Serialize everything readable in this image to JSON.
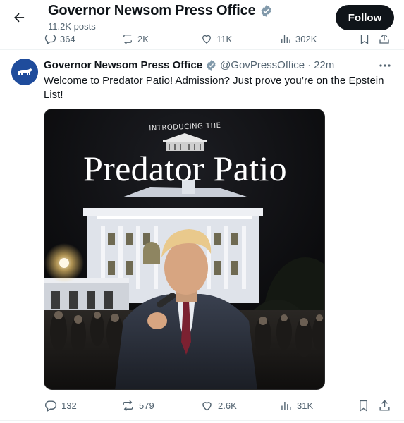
{
  "header": {
    "profile_name": "Governor Newsom Press Office",
    "post_count": "11.2K posts",
    "follow_label": "Follow"
  },
  "previous_tweet_actions": {
    "replies": "364",
    "reposts": "2K",
    "likes": "11K",
    "views": "302K"
  },
  "tweet": {
    "author_name": "Governor Newsom Press Office",
    "handle": "@GovPressOffice",
    "separator": "·",
    "time": "22m",
    "text": "Welcome to Predator Patio! Admission? Just prove you’re on the Epstein List!",
    "media": {
      "kicker": "INTRODUCING THE",
      "title": "Predator Patio"
    },
    "actions": {
      "replies": "132",
      "reposts": "579",
      "likes": "2.6K",
      "views": "31K"
    }
  },
  "colors": {
    "text_primary": "#0f1419",
    "text_secondary": "#536471",
    "verified_badge": "#829aab",
    "avatar_bg": "#1f4c9c",
    "follow_bg": "#0f1419"
  },
  "icons": {
    "back": "arrow-left-icon",
    "verified": "verified-badge-icon",
    "more": "more-dots-icon",
    "reply": "reply-bubble-icon",
    "repost": "repost-arrows-icon",
    "like": "heart-icon",
    "views": "bar-chart-icon",
    "bookmark": "bookmark-icon",
    "share": "share-upload-icon"
  }
}
